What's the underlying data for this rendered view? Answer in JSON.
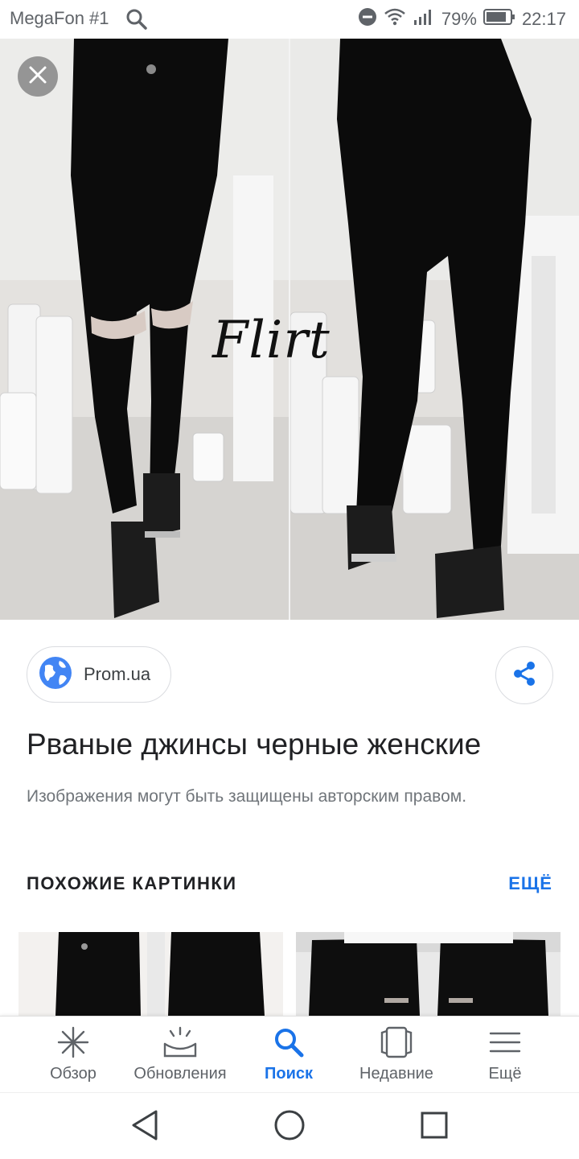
{
  "status_bar": {
    "carrier": "MegaFon #1",
    "battery": "79%",
    "time": "22:17"
  },
  "viewer": {
    "watermark": "Flirt"
  },
  "source": {
    "label": "Prom.ua"
  },
  "result": {
    "title": "Рваные джинсы черные женские",
    "copyright": "Изображения могут быть защищены авторским правом."
  },
  "similar": {
    "heading": "ПОХОЖИЕ КАРТИНКИ",
    "more": "ЕЩЁ"
  },
  "bottom_nav": {
    "items": [
      {
        "label": "Обзор",
        "icon": "asterisk-icon"
      },
      {
        "label": "Обновления",
        "icon": "inbox-icon"
      },
      {
        "label": "Поиск",
        "icon": "search-icon"
      },
      {
        "label": "Недавние",
        "icon": "recent-cards-icon"
      },
      {
        "label": "Ещё",
        "icon": "menu-icon"
      }
    ],
    "active": "Поиск"
  },
  "colors": {
    "accent": "#1a73e8",
    "text_primary": "#202124",
    "text_secondary": "#70757a"
  }
}
